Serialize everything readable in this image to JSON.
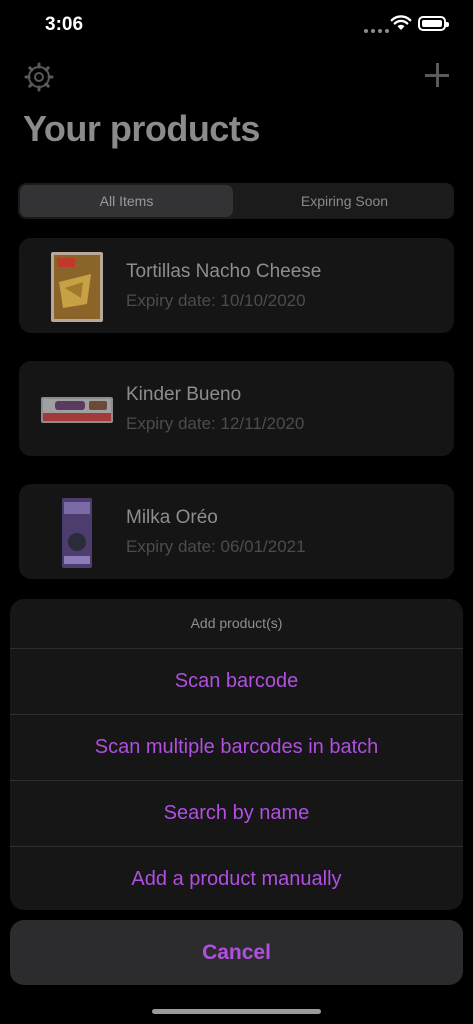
{
  "status_bar": {
    "time": "3:06"
  },
  "header": {
    "title": "Your products",
    "settings_icon": "gear-icon",
    "add_icon": "plus-icon"
  },
  "segments": [
    {
      "label": "All Items",
      "selected": true
    },
    {
      "label": "Expiring Soon",
      "selected": false
    }
  ],
  "products": [
    {
      "name": "Tortillas Nacho Cheese",
      "expiry": "Expiry date: 10/10/2020"
    },
    {
      "name": "Kinder Bueno",
      "expiry": "Expiry date: 12/11/2020"
    },
    {
      "name": "Milka Oréo",
      "expiry": "Expiry date: 06/01/2021"
    }
  ],
  "action_sheet": {
    "title": "Add product(s)",
    "items": [
      "Scan barcode",
      "Scan multiple barcodes in batch",
      "Search by name",
      "Add a product manually"
    ],
    "cancel": "Cancel",
    "accent_color": "#b04fe0"
  }
}
